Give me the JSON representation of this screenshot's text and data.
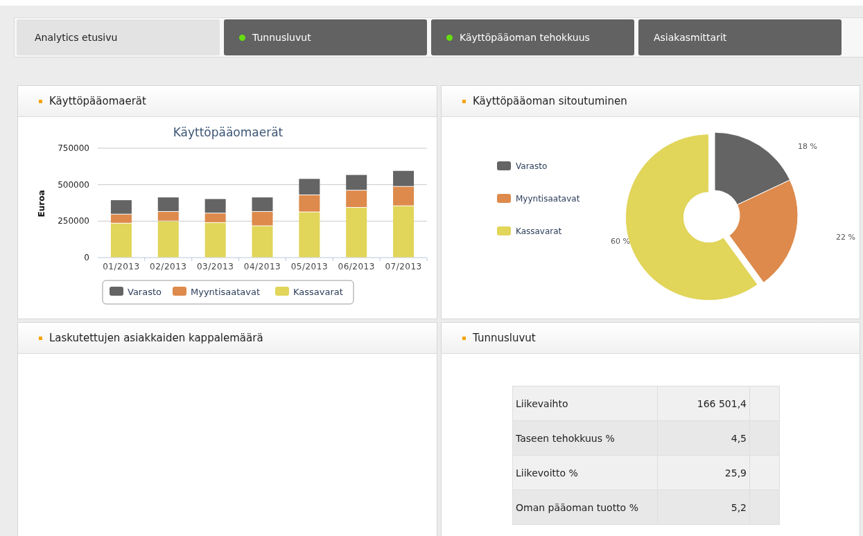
{
  "tabs": [
    {
      "label": "Analytics etusivu",
      "selected": true,
      "indicator": false
    },
    {
      "label": "Tunnusluvut",
      "selected": false,
      "indicator": true
    },
    {
      "label": "Käyttöpääoman tehokkuus",
      "selected": false,
      "indicator": true
    },
    {
      "label": "Asiakasmittarit",
      "selected": false,
      "indicator": false
    }
  ],
  "panels": [
    {
      "title": "Käyttöpääomaerät",
      "chart_data": {
        "type": "bar",
        "title": "Käyttöpääomaerät",
        "legend": "bottom",
        "ylabel": "Euroa",
        "stacked": true,
        "ylim": [
          0,
          750000
        ],
        "yticks": [
          0,
          250000,
          500000,
          750000
        ],
        "categories": [
          "01/2013",
          "02/2013",
          "03/2013",
          "04/2013",
          "05/2013",
          "06/2013",
          "07/2013"
        ],
        "series": [
          {
            "name": "Varasto",
            "color": "#646464",
            "values": [
              98000,
              99000,
              99000,
              99000,
              112000,
              107000,
              109000
            ]
          },
          {
            "name": "Myyntisaatavat",
            "color": "#dd8a4c",
            "values": [
              62000,
              65000,
              65000,
              98000,
              117000,
              118000,
              133000
            ]
          },
          {
            "name": "Kassavarat",
            "color": "#e1d55a",
            "values": [
              236000,
              251000,
              240000,
              218000,
              313000,
              344000,
              355000
            ]
          }
        ]
      }
    },
    {
      "title": "Käyttöpääoman sitoutuminen",
      "chart_data": {
        "type": "donut",
        "categories": [
          "Varasto",
          "Myyntisaatavat",
          "Kassavarat"
        ],
        "legend": "left",
        "series": [
          {
            "values": [
              18,
              22,
              60
            ]
          }
        ],
        "colors": [
          "#646464",
          "#dd8a4c",
          "#e1d55a"
        ],
        "value_labels": [
          "18 %",
          "22 %",
          "60 %"
        ]
      }
    },
    {
      "kind": "empty",
      "title": "Laskutettujen asiakkaiden kappalemäärä"
    },
    {
      "kind": "table",
      "title": "Tunnusluvut",
      "rows": [
        {
          "label": "Liikevaihto",
          "value": "166 501,4"
        },
        {
          "label": "Taseen tehokkuus %",
          "value": "4,5"
        },
        {
          "label": "Liikevoitto %",
          "value": "25,9"
        },
        {
          "label": "Oman pääoman tuotto %",
          "value": "5,2"
        }
      ]
    }
  ]
}
